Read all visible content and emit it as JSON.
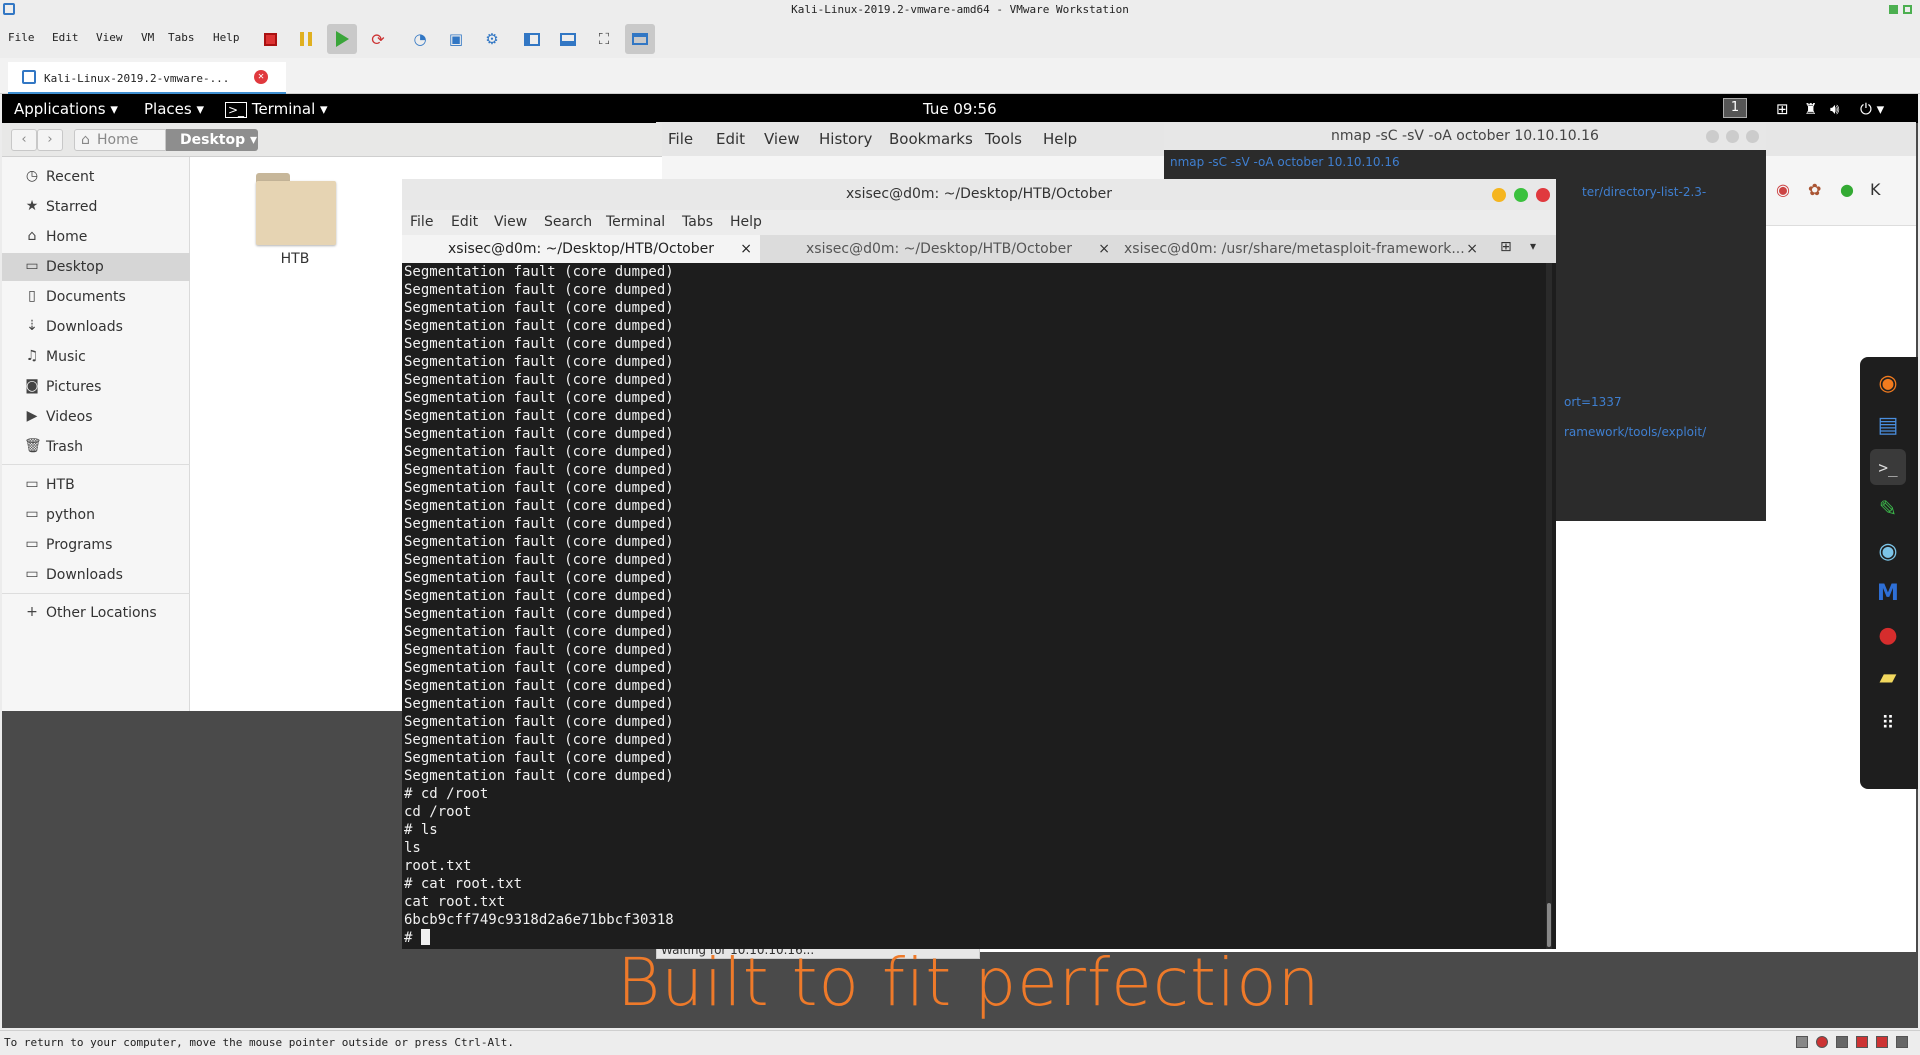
{
  "vmware": {
    "title": "Kali-Linux-2019.2-vmware-amd64 - VMware Workstation",
    "menu": [
      "File",
      "Edit",
      "View",
      "VM",
      "Tabs",
      "Help"
    ],
    "tab_label": "Kali-Linux-2019.2-vmware-...",
    "status_text": "To return to your computer, move the mouse pointer outside or press Ctrl-Alt."
  },
  "gnome_topbar": {
    "applications": "Applications",
    "places": "Places",
    "terminal": "Terminal",
    "clock": "Tue 09:56",
    "workspace": "1"
  },
  "files": {
    "path_home": "Home",
    "path_current": "Desktop",
    "sidebar": [
      {
        "label": "Recent",
        "icon": "clock-icon"
      },
      {
        "label": "Starred",
        "icon": "star-icon"
      },
      {
        "label": "Home",
        "icon": "home-icon"
      },
      {
        "label": "Desktop",
        "icon": "desktop-icon",
        "selected": true
      },
      {
        "label": "Documents",
        "icon": "document-icon"
      },
      {
        "label": "Downloads",
        "icon": "download-icon"
      },
      {
        "label": "Music",
        "icon": "music-icon"
      },
      {
        "label": "Pictures",
        "icon": "camera-icon"
      },
      {
        "label": "Videos",
        "icon": "video-icon"
      },
      {
        "label": "Trash",
        "icon": "trash-icon"
      }
    ],
    "bookmarks": [
      "HTB",
      "python",
      "Programs",
      "Downloads"
    ],
    "other_locations": "Other Locations",
    "folder_name": "HTB"
  },
  "firefox": {
    "menu": [
      "File",
      "Edit",
      "View",
      "History",
      "Bookmarks",
      "Tools",
      "Help"
    ],
    "status": "Waiting for 10.10.10.16..."
  },
  "nmap_window": {
    "title": "nmap -sC -sV -oA october 10.10.10.16",
    "command": "nmap -sC -sV -oA october 10.10.10.16",
    "partial_lines": [
      "ter/directory-list-2.3-",
      "ort=1337",
      "ramework/tools/exploit/"
    ]
  },
  "terminal": {
    "title": "xsisec@d0m: ~/Desktop/HTB/October",
    "menu": [
      "File",
      "Edit",
      "View",
      "Search",
      "Terminal",
      "Tabs",
      "Help"
    ],
    "tabs": [
      "xsisec@d0m: ~/Desktop/HTB/October",
      "xsisec@d0m: ~/Desktop/HTB/October",
      "xsisec@d0m: /usr/share/metasploit-framework..."
    ],
    "segfault_line": "Segmentation fault (core dumped)",
    "segfault_count": 29,
    "lines_after": [
      "# cd /root",
      "cd /root",
      "# ls",
      "ls",
      "root.txt",
      "# cat root.txt",
      "cat root.txt",
      "6bcb9cff749c9318d2a6e71bbcf30318",
      "# "
    ]
  },
  "wallpaper_text": "Built to fit perfection",
  "colors": {
    "accent_orange": "#ee7a2a",
    "close_red": "#e0393e",
    "min_yellow": "#f5b51f",
    "max_green": "#3bc13e"
  }
}
